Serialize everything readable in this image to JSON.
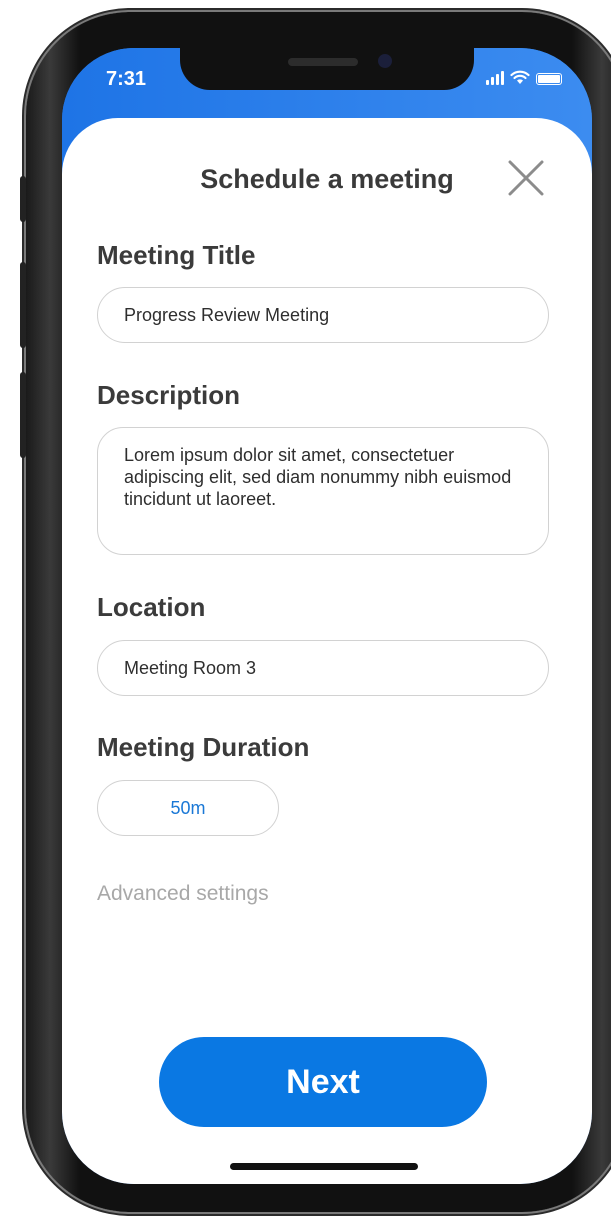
{
  "status_bar": {
    "time": "7:31",
    "icons": [
      "signal-icon",
      "wifi-icon",
      "battery-icon"
    ]
  },
  "header": {
    "title": "Schedule a meeting",
    "close_icon": "close-icon"
  },
  "form": {
    "meeting_title": {
      "label": "Meeting Title",
      "value": "Progress Review Meeting"
    },
    "description": {
      "label": "Description",
      "value": "Lorem ipsum dolor sit amet, consectetuer adipiscing elit, sed diam nonummy nibh euismod tincidunt ut laoreet."
    },
    "location": {
      "label": "Location",
      "value": "Meeting Room 3"
    },
    "duration": {
      "label": "Meeting Duration",
      "value": "50m"
    },
    "advanced_settings": "Advanced settings"
  },
  "actions": {
    "next_label": "Next"
  },
  "colors": {
    "accent": "#0a78e3",
    "header_blue": "#2f7fe6",
    "duration_text": "#1a78d6",
    "muted_text": "#a8a8a8"
  }
}
